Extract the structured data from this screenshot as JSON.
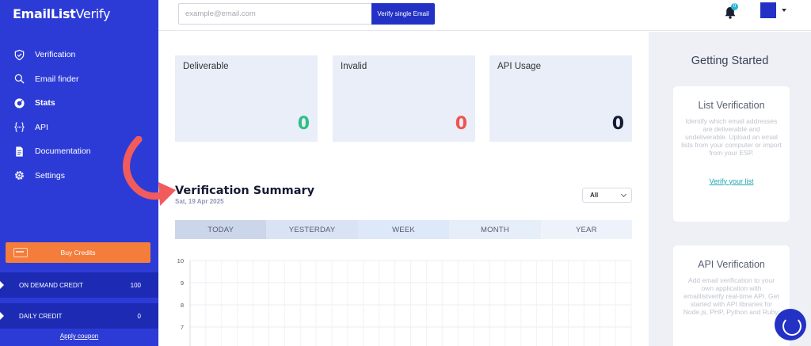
{
  "sidebar": {
    "logo_bold": "EmailList",
    "logo_light": "Verify",
    "items": [
      {
        "label": "Verification",
        "icon": "shield-check-icon"
      },
      {
        "label": "Email finder",
        "icon": "search-icon"
      },
      {
        "label": "Stats",
        "icon": "stats-icon",
        "active": true
      },
      {
        "label": "API",
        "icon": "braces-icon"
      },
      {
        "label": "Documentation",
        "icon": "document-icon"
      },
      {
        "label": "Settings",
        "icon": "gear-icon"
      }
    ],
    "buy_credits": "Buy Credits",
    "credits": [
      {
        "name": "ON DEMAND CREDIT",
        "value": "100"
      },
      {
        "name": "DAILY CREDIT",
        "value": "0"
      }
    ],
    "apply_coupon": "Apply coupon"
  },
  "topbar": {
    "email_placeholder": "example@email.com",
    "verify_button": "Verify single Email",
    "notification_count": "0"
  },
  "stats": [
    {
      "title": "Deliverable",
      "value": "0",
      "color": "#2fbf85"
    },
    {
      "title": "Invalid",
      "value": "0",
      "color": "#f0534f"
    },
    {
      "title": "API Usage",
      "value": "0",
      "color": "#141a33"
    }
  ],
  "summary": {
    "title": "Verification Summary",
    "date": "Sat, 19 Apr 2025",
    "filter": "All",
    "tabs": [
      "TODAY",
      "YESTERDAY",
      "WEEK",
      "MONTH",
      "YEAR"
    ]
  },
  "chart_data": {
    "type": "line",
    "title": "",
    "xlabel": "",
    "ylabel": "",
    "y_ticks": [
      "10",
      "9",
      "8",
      "7"
    ],
    "ylim": [
      7,
      10
    ],
    "grid": true,
    "series": []
  },
  "right_panel": {
    "title": "Getting Started",
    "list_card": {
      "title": "List Verification",
      "desc": "Identify which email addresses are deliverable and undeliverable. Upload an email lists from your computer or import from your ESP.",
      "link": "Verify your list"
    },
    "api_card": {
      "title": "API Verification",
      "desc": "Add email verification to your own application with emaillistverify real-time API. Get started with API libraries for Node.js, PHP, Python and Ruby."
    }
  },
  "colors": {
    "sidebar": "#2d3bd6",
    "accent": "#2332c5",
    "buy_button": "#f47d3b",
    "arrow": "#f25b5b"
  }
}
